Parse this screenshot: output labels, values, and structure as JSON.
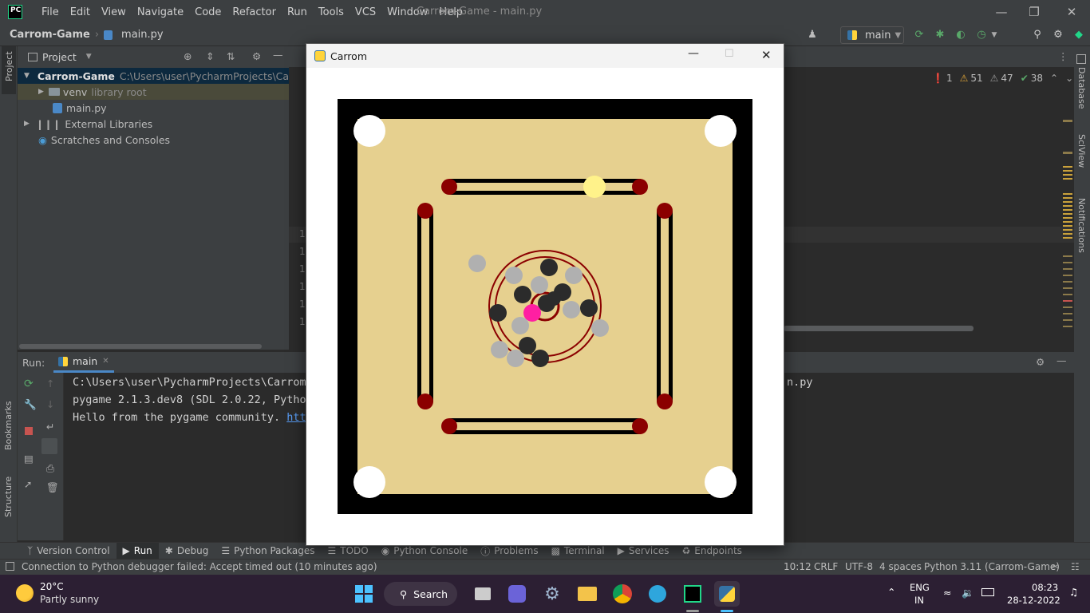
{
  "titlebar": {
    "logo": "PC",
    "menu": [
      "File",
      "Edit",
      "View",
      "Navigate",
      "Code",
      "Refactor",
      "Run",
      "Tools",
      "VCS",
      "Window",
      "Help"
    ],
    "window_title": "Carrom-Game - main.py"
  },
  "navbar": {
    "project": "Carrom-Game",
    "file": "main.py",
    "branch": "main"
  },
  "project_panel": {
    "title": "Project",
    "tree": [
      {
        "label": "Carrom-Game",
        "path": "C:\\Users\\user\\PycharmProjects\\Carrom-"
      },
      {
        "label": "venv",
        "note": "library root"
      },
      {
        "label": "main.py"
      },
      {
        "label": "External Libraries"
      },
      {
        "label": "Scratches and Consoles"
      }
    ]
  },
  "left_stripe": {
    "project": "Project",
    "bookmarks": "Bookmarks",
    "structure": "Structure"
  },
  "right_stripe": {
    "database": "Database",
    "sciview": "SciView",
    "notifications": "Notifications"
  },
  "inspections": {
    "errors": "1",
    "warnings": "51",
    "weak_warnings": "47",
    "ok": "38"
  },
  "editor": {
    "line_numbers": [
      "1",
      "1",
      "1",
      "1",
      "1",
      "1"
    ]
  },
  "run_panel": {
    "label": "Run:",
    "tab": "main",
    "console": [
      "C:\\Users\\user\\PycharmProjects\\Carrom-",
      "pygame 2.1.3.dev8 (SDL 2.0.22, Python",
      "Hello from the pygame community. "
    ],
    "console_link": "http",
    "console_tail": "n.py"
  },
  "bottom_tools": [
    "Version Control",
    "Run",
    "Debug",
    "Python Packages",
    "TODO",
    "Python Console",
    "Problems",
    "Terminal",
    "Services",
    "Endpoints"
  ],
  "statusbar": {
    "message": "Connection to Python debugger failed: Accept timed out (10 minutes ago)",
    "position": "10:12",
    "line_sep": "CRLF",
    "encoding": "UTF-8",
    "indent": "4 spaces",
    "interpreter": "Python 3.11 (Carrom-Game)"
  },
  "taskbar": {
    "temperature": "20°C",
    "weather": "Partly sunny",
    "search": "Search",
    "lang": "ENG",
    "region": "IN",
    "time": "08:23",
    "date": "28-12-2022"
  },
  "pygame_window": {
    "title": "Carrom",
    "colors": {
      "frame": "#000000",
      "surface": "#e6d08f",
      "red": "#8b0000",
      "white_coin": "#b0b0b0",
      "black_coin": "#2b2b2b",
      "queen": "#ff1fa2",
      "striker": "#fff28a",
      "pocket": "#ffffff"
    },
    "pockets": 4,
    "white_coins": 9,
    "black_coins": 9,
    "queen": 1,
    "striker": 1
  }
}
